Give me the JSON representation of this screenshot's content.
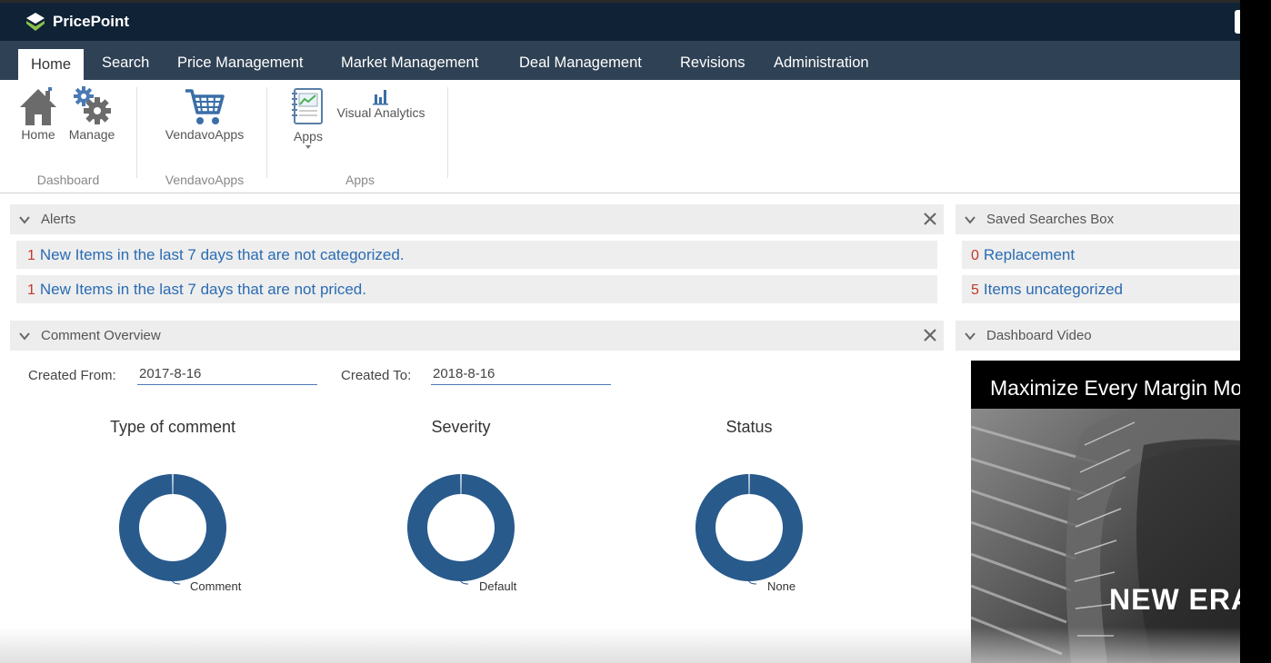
{
  "app": {
    "title": "PricePoint"
  },
  "nav": {
    "tabs": [
      {
        "label": "Home",
        "active": true
      },
      {
        "label": "Search"
      },
      {
        "label": "Price Management"
      },
      {
        "label": "Market Management"
      },
      {
        "label": "Deal Management"
      },
      {
        "label": "Revisions"
      },
      {
        "label": "Administration"
      }
    ]
  },
  "ribbon": {
    "groups": [
      {
        "label": "Dashboard",
        "buttons": [
          {
            "label": "Home",
            "icon": "home-icon"
          },
          {
            "label": "Manage",
            "icon": "gears-icon"
          }
        ]
      },
      {
        "label": "VendavoApps",
        "buttons": [
          {
            "label": "VendavoApps",
            "icon": "cart-icon"
          }
        ]
      },
      {
        "label": "Apps",
        "buttons": [
          {
            "label": "Apps",
            "icon": "notebook-chart-icon"
          },
          {
            "label": "Visual Analytics",
            "icon": "bar-chart-icon"
          }
        ]
      }
    ]
  },
  "alerts": {
    "title": "Alerts",
    "items": [
      {
        "count": "1",
        "text": "New Items in the last 7 days that are not categorized."
      },
      {
        "count": "1",
        "text": "New Items in the last 7 days that are not priced."
      }
    ]
  },
  "saved_searches": {
    "title": "Saved Searches Box",
    "items": [
      {
        "count": "0",
        "text": "Replacement"
      },
      {
        "count": "5",
        "text": "Items uncategorized"
      }
    ]
  },
  "comment_overview": {
    "title": "Comment Overview",
    "created_from_label": "Created From:",
    "created_from_value": "2017-8-16",
    "created_to_label": "Created To:",
    "created_to_value": "2018-8-16",
    "charts": [
      {
        "title": "Type of comment",
        "slice_label": "Comment"
      },
      {
        "title": "Severity",
        "slice_label": "Default"
      },
      {
        "title": "Status",
        "slice_label": "None"
      }
    ]
  },
  "dashboard_video": {
    "title": "Dashboard Video",
    "headline": "Maximize Every Margin Mo",
    "caption": "NEW ERA"
  },
  "colors": {
    "topbar": "#0f2236",
    "nav": "#2f4154",
    "donut": "#285a8c",
    "link": "#2a6bb3",
    "count": "#c0392b"
  },
  "chart_data": [
    {
      "type": "pie",
      "title": "Type of comment",
      "categories": [
        "Comment"
      ],
      "values": [
        100
      ]
    },
    {
      "type": "pie",
      "title": "Severity",
      "categories": [
        "Default"
      ],
      "values": [
        100
      ]
    },
    {
      "type": "pie",
      "title": "Status",
      "categories": [
        "None"
      ],
      "values": [
        100
      ]
    }
  ]
}
